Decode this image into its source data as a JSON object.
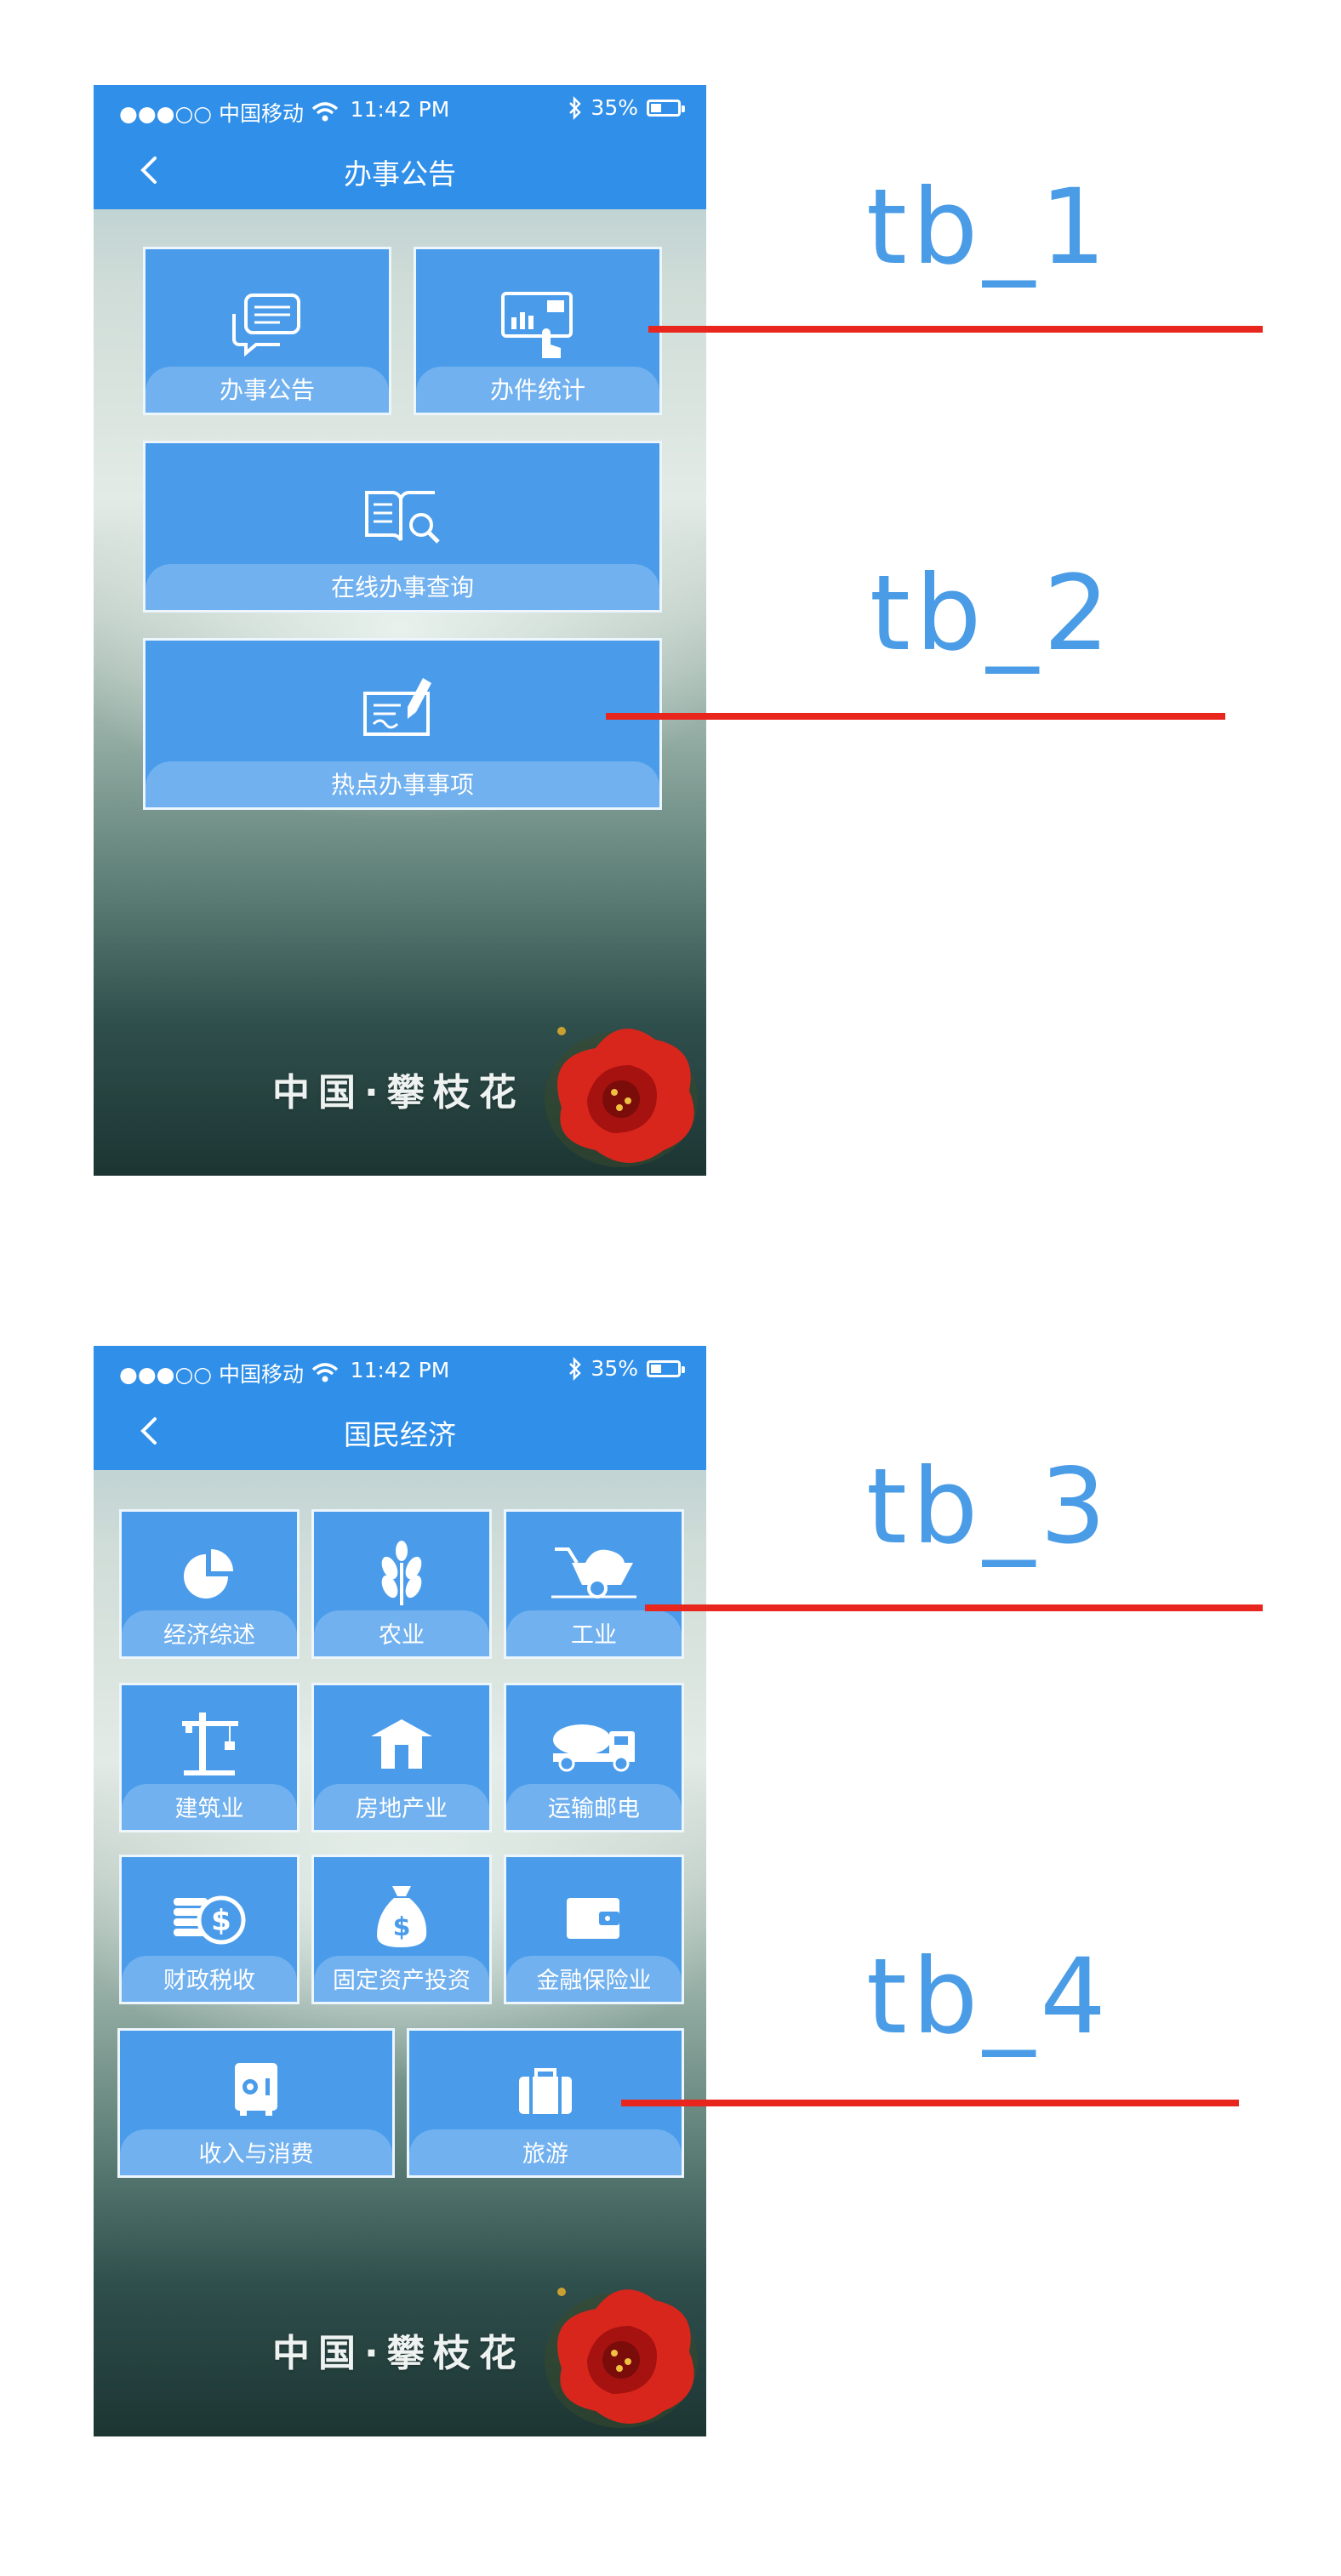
{
  "status_bar": {
    "carrier": "●●●○○ 中国移动",
    "time": "11:42  PM",
    "battery": "35%"
  },
  "screens": [
    {
      "title": "办事公告",
      "tiles": [
        "办事公告",
        "办件统计",
        "在线办事查询",
        "热点办事事项"
      ],
      "brand": "中国·攀枝花"
    },
    {
      "title": "国民经济",
      "tiles": [
        "经济综述",
        "农业",
        "工业",
        "建筑业",
        "房地产业",
        "运输邮电",
        "财政税收",
        "固定资产投资",
        "金融保险业",
        "收入与消费",
        "旅游"
      ],
      "brand": "中国·攀枝花"
    }
  ],
  "annotations": [
    "tb_1",
    "tb_2",
    "tb_3",
    "tb_4"
  ],
  "colors": {
    "nav_blue": "#2f8fe9",
    "tile_blue": "#4a9ceb",
    "annotation_blue": "#4a9ce6",
    "annotation_line": "#e8261d"
  },
  "icons": {
    "screen1": [
      "chat-bubbles-icon",
      "stats-touch-icon",
      "book-search-icon",
      "certificate-pen-icon"
    ],
    "screen2": [
      "pie-chart-icon",
      "wheat-icon",
      "wheelbarrow-icon",
      "crane-icon",
      "house-icon",
      "cement-truck-icon",
      "coins-dollar-icon",
      "money-bag-icon",
      "wallet-icon",
      "safe-icon",
      "suitcase-icon"
    ]
  }
}
